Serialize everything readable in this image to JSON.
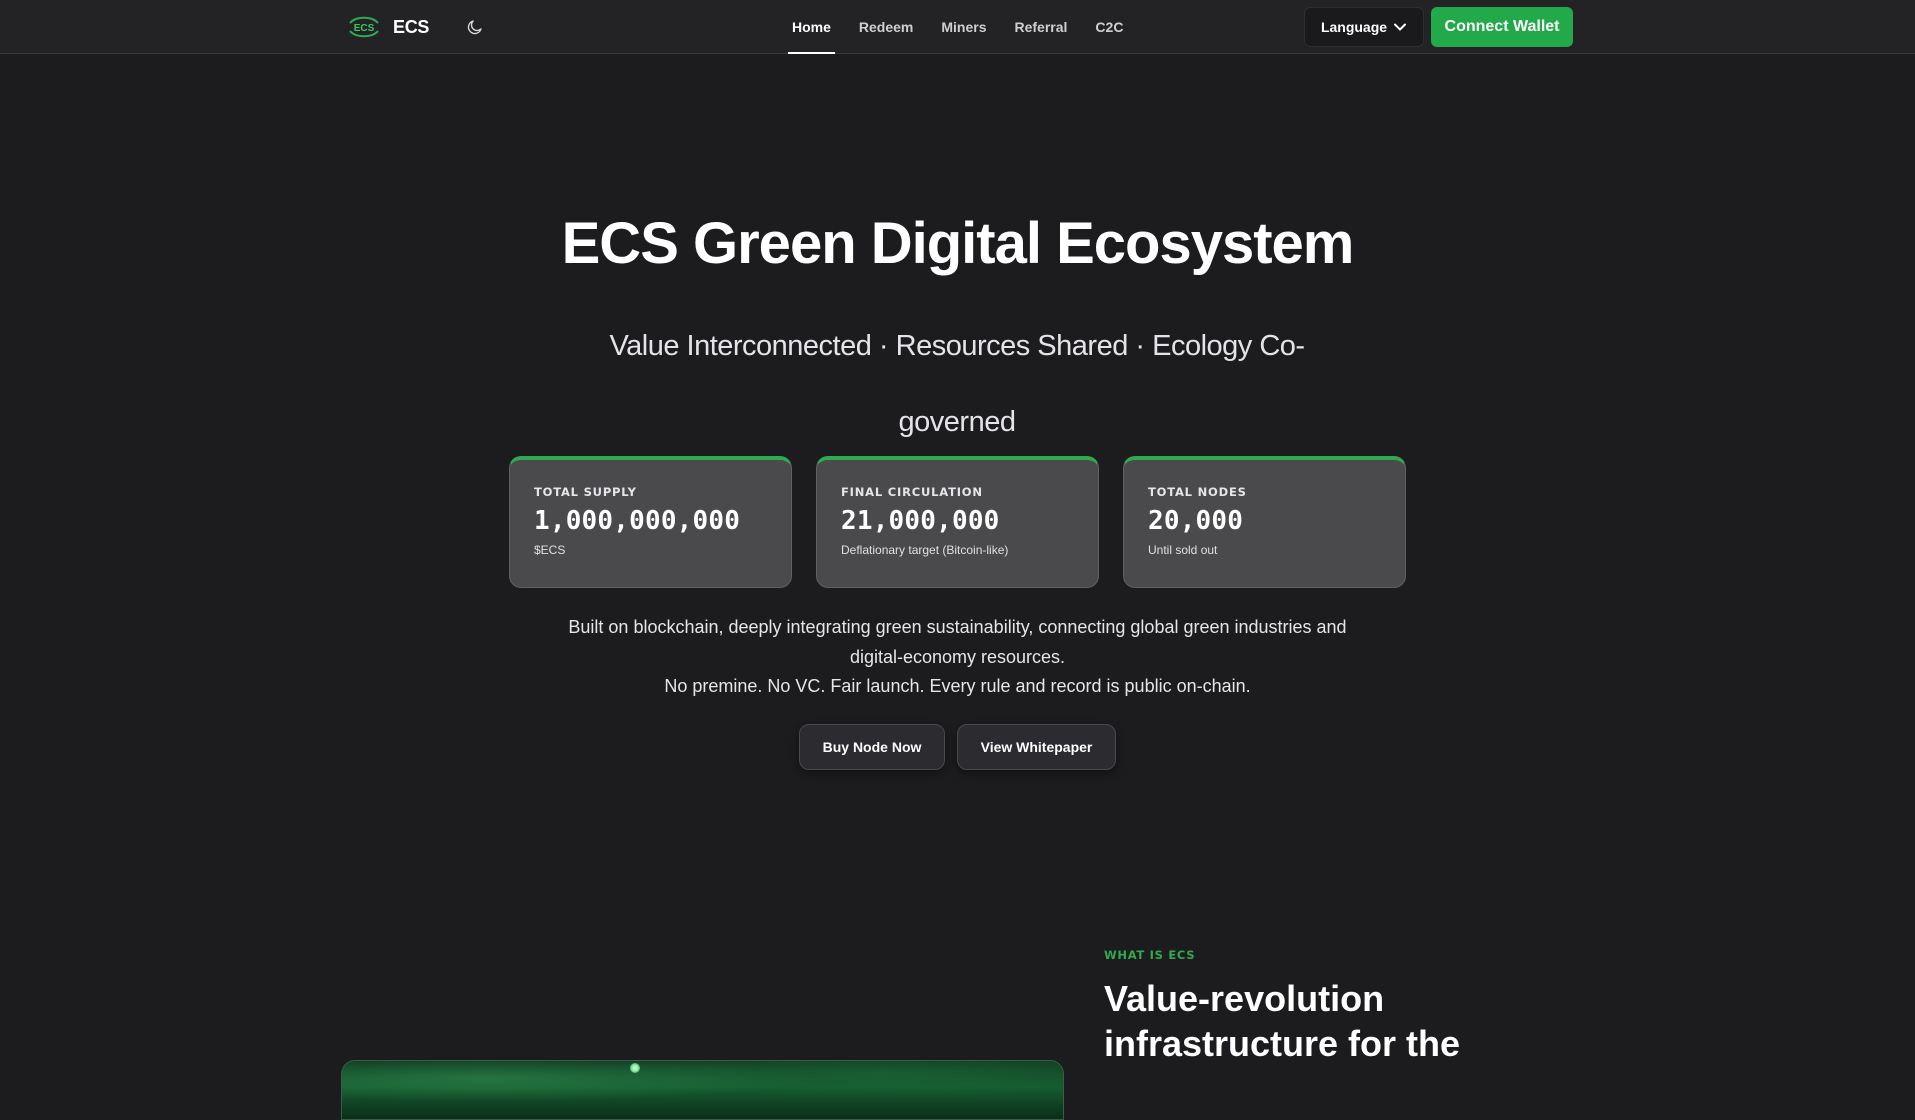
{
  "header": {
    "logo_text": "ECS",
    "logo_mark_text": "ECS",
    "theme_icon": "moon-icon",
    "nav": [
      {
        "label": "Home",
        "active": true
      },
      {
        "label": "Redeem",
        "active": false
      },
      {
        "label": "Miners",
        "active": false
      },
      {
        "label": "Referral",
        "active": false
      },
      {
        "label": "C2C",
        "active": false
      }
    ],
    "language_label": "Language",
    "language_icon": "chevron-down-icon",
    "connect_label": "Connect Wallet"
  },
  "hero": {
    "title": "ECS Green Digital Ecosystem",
    "subtitle": "Value Interconnected · Resources Shared · Ecology Co-governed",
    "stats": [
      {
        "label": "TOTAL SUPPLY",
        "value": "1,000,000,000",
        "note": "$ECS"
      },
      {
        "label": "FINAL CIRCULATION",
        "value": "21,000,000",
        "note": "Deflationary target (Bitcoin-like)"
      },
      {
        "label": "TOTAL NODES",
        "value": "20,000",
        "note": "Until sold out"
      }
    ],
    "description_line1": "Built on blockchain, deeply integrating green sustainability, connecting global green industries and digital-economy resources.",
    "description_line2": "No premine. No VC. Fair launch. Every rule and record is public on-chain.",
    "buy_label": "Buy Node Now",
    "whitepaper_label": "View Whitepaper"
  },
  "about": {
    "eyebrow": "WHAT IS ECS",
    "title": "Value-revolution infrastructure for the"
  },
  "colors": {
    "accent": "#22a94a",
    "background": "#1c1c1f",
    "header": "#232326",
    "card": "#4a4a4d"
  }
}
